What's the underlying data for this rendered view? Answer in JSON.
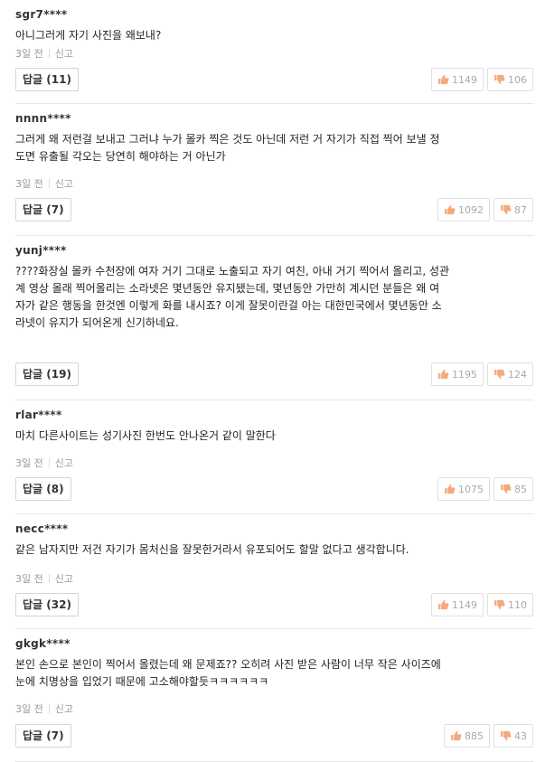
{
  "comments": [
    {
      "author": "sgr7****",
      "lines": [
        "아니그러게 자기 사진을 왜보내?"
      ],
      "time": "3일 전",
      "report": "신고",
      "reply": "답글",
      "reply_count": "(11)",
      "up": "1149",
      "down": "106"
    },
    {
      "author": "nnnn****",
      "lines": [
        "그러게 왜 저런걸 보내고 그러냐 누가 몰카 찍은 것도 아닌데 저런 거 자기가 직접 찍어 보낼 정",
        "도면 유출될 각오는 당연히 해야하는 거 아닌가"
      ],
      "time": "3일 전",
      "report": "신고",
      "reply": "답글",
      "reply_count": "(7)",
      "up": "1092",
      "down": "87"
    },
    {
      "author": "yunj****",
      "lines": [
        "????화장실 몰카 수천장에 여자 거기 그대로 노출되고 자기 여친, 아내 거기 찍어서 올리고, 성관",
        "계 영상 몰래 찍어올리는 소라넷은 몇년동안 유지됐는데, 몇년동안 가만히 계시던 분들은 왜 여",
        "자가 같은 행동을 한것엔 이렇게 화를 내시죠? 이게 잘못이란걸 아는 대한민국에서 몇년동안 소",
        "라넷이 유지가 되어온게 신기하네요."
      ],
      "time": "",
      "report": "",
      "reply": "답글",
      "reply_count": "(19)",
      "up": "1195",
      "down": "124"
    },
    {
      "author": "rlar****",
      "lines": [
        "마치 다른사이트는 성기사진 한번도 안나온거 같이 말한다"
      ],
      "time": "3일 전",
      "report": "신고",
      "reply": "답글",
      "reply_count": "(8)",
      "up": "1075",
      "down": "85"
    },
    {
      "author": "necc****",
      "lines": [
        "같은 남자지만 저건 자기가 몸처신을 잘못한거라서 유포되어도 할말 없다고 생각합니다."
      ],
      "time": "3일 전",
      "report": "신고",
      "reply": "답글",
      "reply_count": "(32)",
      "up": "1149",
      "down": "110"
    },
    {
      "author": "gkgk****",
      "lines": [
        "본인 손으로 본인이 찍어서 올렸는데 왜 문제죠?? 오히려 사진 받은 사람이 너무 작은 사이즈에",
        "눈에 치명상을 입었기 때문에 고소해야할듯ㅋㅋㅋㅋㅋㅋ"
      ],
      "time": "3일 전",
      "report": "신고",
      "reply": "답글",
      "reply_count": "(7)",
      "up": "885",
      "down": "43"
    }
  ]
}
